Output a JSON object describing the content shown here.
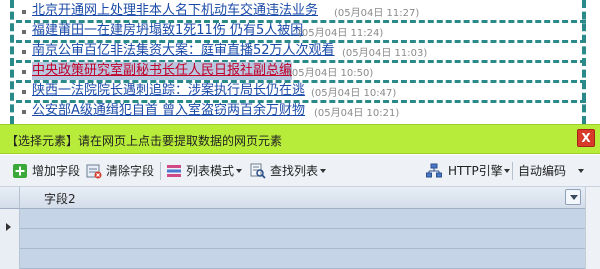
{
  "news": {
    "items": [
      {
        "title": "北京开通网上处理非本人名下机动车交通违法业务",
        "time": "(05月04日 11:27)",
        "selected": false
      },
      {
        "title": "福建莆田一在建房坍塌致1死11伤 仍有5人被困",
        "time": "(05月04日 11:24)",
        "selected": false
      },
      {
        "title": "南京公审百亿非法集资大案：庭审直播52万人次观看",
        "time": "(05月04日 11:03)",
        "selected": false
      },
      {
        "title": "中央政策研究室副秘书长任人民日报社副总编",
        "time": "(05月04日 10:50)",
        "selected": true
      },
      {
        "title": "陕西一法院院长遇刺追踪：涉案执行局长仍在逃",
        "time": "(05月04日 10:47)",
        "selected": false
      },
      {
        "title": "公安部A级通缉犯自首 曾入室盗窃两百余万财物",
        "time": "(05月04日 10:21)",
        "selected": false
      }
    ]
  },
  "hint_bar": {
    "text": "【选择元素】请在网页上点击要提取数据的网页元素",
    "close_label": "X",
    "color": "#b8ec3a"
  },
  "toolbar": {
    "add_field": "增加字段",
    "clear_field": "清除字段",
    "list_mode": "列表模式",
    "find_list": "查找列表",
    "http_engine": "HTTP引擎",
    "auto_encoding": "自动编码"
  },
  "grid": {
    "column_header": "字段2"
  }
}
